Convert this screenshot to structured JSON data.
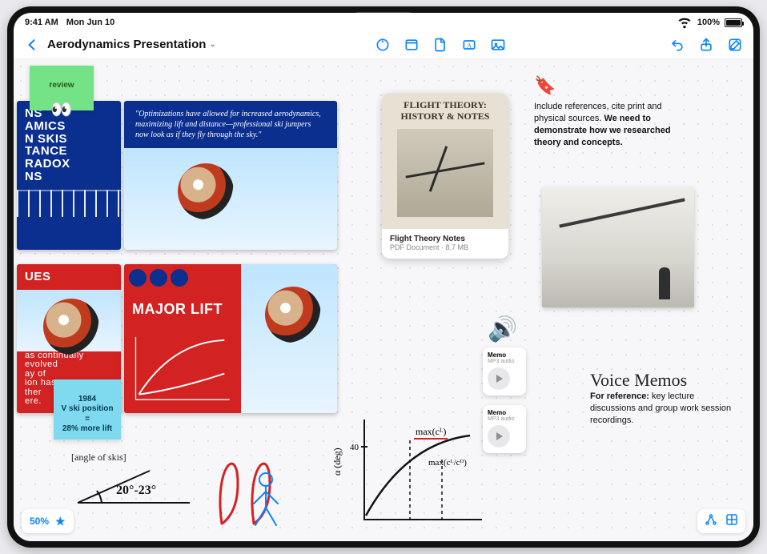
{
  "status": {
    "time": "9:41 AM",
    "date": "Mon Jun 10",
    "battery": "100%"
  },
  "toolbar": {
    "title": "Aerodynamics Presentation",
    "tools": {
      "back": "back-chevron",
      "markup": "markup",
      "note": "sticky-note",
      "file": "document",
      "textbox": "textbox",
      "photo": "photo",
      "undo": "undo",
      "share": "share",
      "compose": "compose"
    }
  },
  "stickies": {
    "review": "review",
    "lift": "1984\nV ski position\n=\n28% more lift"
  },
  "slides": {
    "left_top": "NS\nAMICS\nN SKIS\nTANCE\nRADOX\nNS",
    "left_bottom_title": "UES",
    "left_bottom_caption": "as continually evolved\nay of\nion has\nther\nere.",
    "quote": "\"Optimizations have allowed for increased aerodynamics, maximizing lift and distance—professional ski jumpers now look as if they fly through the sky.\"",
    "lift_title": "MAJOR LIFT"
  },
  "pdf": {
    "cover_title": "FLIGHT THEORY:\nHISTORY & NOTES",
    "name": "Flight Theory Notes",
    "meta": "PDF Document · 8.7 MB"
  },
  "ref": {
    "line1": "Include references, cite print and physical sources.",
    "line2": "We need to demonstrate how we researched theory and concepts."
  },
  "memos": {
    "title": "Voice Memos",
    "body_label": "For reference:",
    "body_rest": " key lecture discussions and group work session recordings.",
    "item1_name": "Memo",
    "item1_type": "MP3 audio",
    "item2_name": "Memo",
    "item2_type": "MP3 audio"
  },
  "handwriting": {
    "angle_label": "[angle of skis]",
    "angle_range": "20°-23°",
    "y_axis": "α (deg)",
    "y_tick": "40",
    "annot_top": "max(cᴸ)",
    "annot_mid": "max(cᴸ/cᴰ)"
  },
  "zoom": "50%"
}
